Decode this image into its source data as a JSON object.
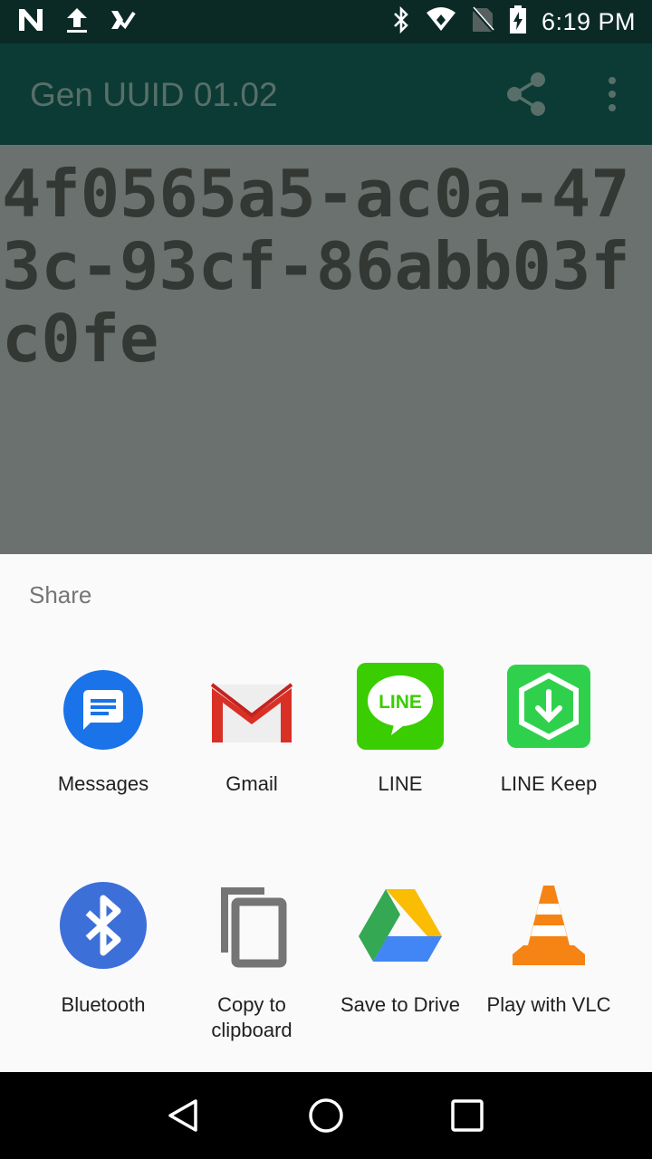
{
  "status_bar": {
    "time": "6:19 PM",
    "left_icons": [
      "n-logo-icon",
      "upload-icon",
      "checklist-icon"
    ],
    "right_icons": [
      "bluetooth-icon",
      "wifi-icon",
      "no-sim-icon",
      "battery-charging-icon"
    ]
  },
  "app_bar": {
    "title": "Gen UUID 01.02",
    "actions": [
      "share-icon",
      "overflow-menu-icon"
    ]
  },
  "content": {
    "uuid_text": "4f0565a5-ac0a-473c-93cf-86abb03fc0fe"
  },
  "share_sheet": {
    "title": "Share",
    "targets": [
      {
        "label": "Messages",
        "icon": "messages-icon"
      },
      {
        "label": "Gmail",
        "icon": "gmail-icon"
      },
      {
        "label": "LINE",
        "icon": "line-icon",
        "icon_text": "LINE"
      },
      {
        "label": "LINE Keep",
        "icon": "line-keep-icon"
      },
      {
        "label": "Bluetooth",
        "icon": "bluetooth-app-icon"
      },
      {
        "label": "Copy to clipboard",
        "icon": "copy-icon"
      },
      {
        "label": "Save to Drive",
        "icon": "drive-icon"
      },
      {
        "label": "Play with VLC",
        "icon": "vlc-icon"
      }
    ]
  },
  "nav_bar": {
    "buttons": [
      "back-icon",
      "home-icon",
      "recents-icon"
    ]
  },
  "colors": {
    "status_bar": "#0b2a26",
    "app_bar": "#0c3b35",
    "scrim_content": "#6b716e",
    "sheet_bg": "#fafafa",
    "line_green": "#3acd01",
    "keep_green": "#2fd14c",
    "messages_blue": "#1a73e8",
    "bluetooth_blue": "#3d6fd9",
    "vlc_orange": "#f58414"
  }
}
